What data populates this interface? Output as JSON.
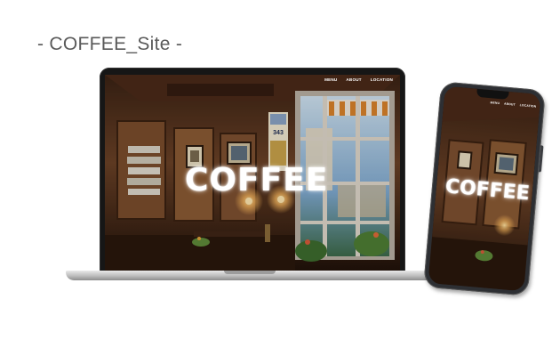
{
  "page": {
    "title": "- COFFEE_Site -"
  },
  "laptop": {
    "hero_text": "COFFEE",
    "nav": [
      "MENU",
      "ABOUT",
      "LOCATION"
    ]
  },
  "phone": {
    "hero_text": "COFFEE",
    "nav": [
      "MENU",
      "ABOUT",
      "LOCATION"
    ]
  },
  "scene": {
    "poster_text": "343"
  },
  "colors": {
    "wood_dark": "#2a1810",
    "wood_mid": "#5b3520",
    "lamp_glow": "#f3b25a",
    "window_sky": "#9fc6e4",
    "awning_orange": "#d9822b"
  }
}
